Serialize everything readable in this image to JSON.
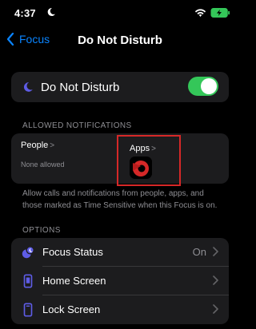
{
  "status": {
    "time": "4:37"
  },
  "nav": {
    "back_label": "Focus",
    "title": "Do Not Disturb"
  },
  "dnd": {
    "label": "Do Not Disturb",
    "enabled": true
  },
  "allowed": {
    "header": "ALLOWED NOTIFICATIONS",
    "people_label": "People",
    "people_sub": "None allowed",
    "apps_label": "Apps",
    "chevron": ">",
    "footnote": "Allow calls and notifications from people, apps, and those marked as Time Sensitive when this Focus is on."
  },
  "options": {
    "header": "OPTIONS",
    "items": [
      {
        "label": "Focus Status",
        "value": "On"
      },
      {
        "label": "Home Screen"
      },
      {
        "label": "Lock Screen"
      }
    ]
  },
  "colors": {
    "accent": "#0a84ff",
    "toggle_on": "#34c759",
    "icon_purple": "#5e5ce6",
    "highlight": "#d62828"
  }
}
